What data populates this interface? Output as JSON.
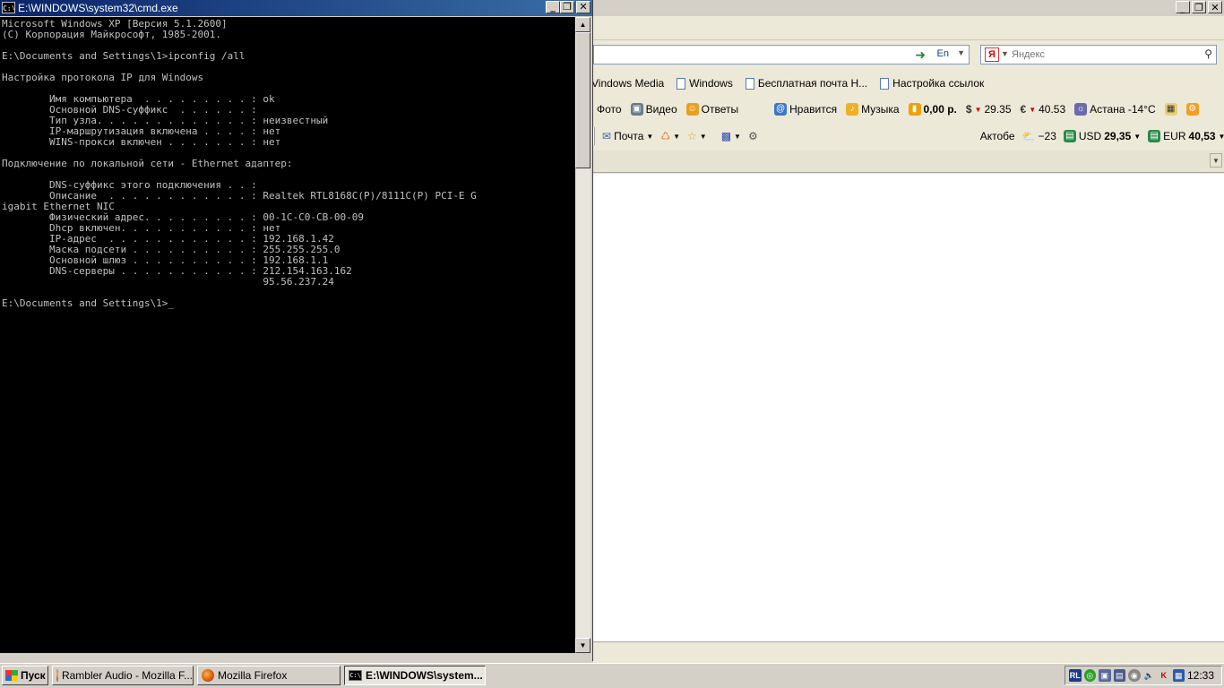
{
  "cmd": {
    "title": "E:\\WINDOWS\\system32\\cmd.exe",
    "icon_text": "C:\\",
    "console_lines": [
      "Microsoft Windows XP [Версия 5.1.2600]",
      "(С) Корпорация Майкрософт, 1985-2001.",
      "",
      "E:\\Documents and Settings\\1>ipconfig /all",
      "",
      "Настройка протокола IP для Windows",
      "",
      "        Имя компьютера  . . . . . . . . . : ok",
      "        Основной DNS-суффикс  . . . . . . :",
      "        Тип узла. . . . . . . . . . . . . : неизвестный",
      "        IP-маршрутизация включена . . . . : нет",
      "        WINS-прокси включен . . . . . . . : нет",
      "",
      "Подключение по локальной сети - Ethernet адаптер:",
      "",
      "        DNS-суффикс этого подключения . . :",
      "        Описание  . . . . . . . . . . . . : Realtek RTL8168C(P)/8111C(P) PCI-E G",
      "igabit Ethernet NIC",
      "        Физический адрес. . . . . . . . . : 00-1C-C0-CB-00-09",
      "        Dhcp включен. . . . . . . . . . . : нет",
      "        IP-адрес  . . . . . . . . . . . . : 192.168.1.42",
      "        Маска подсети . . . . . . . . . . : 255.255.255.0",
      "        Основной шлюз . . . . . . . . . . : 192.168.1.1",
      "        DNS-серверы . . . . . . . . . . . : 212.154.163.162",
      "                                            95.56.237.24",
      "",
      "E:\\Documents and Settings\\1>"
    ],
    "cursor": "_"
  },
  "firefox": {
    "url_lang": "En",
    "search_placeholder": "Яндекс",
    "bookmarks": [
      "Vindows Media",
      "Windows",
      "Бесплатная почта Н...",
      "Настройка ссылок"
    ],
    "yandex_bar": {
      "photo": "Фото",
      "video": "Видео",
      "answers": "Ответы",
      "likes": "Нравится",
      "music": "Музыка",
      "money": "0,00 р.",
      "usd": "29.35",
      "eur": "40.53",
      "weather_city": "Астана -14°C"
    },
    "toolbar3": {
      "mail": "Почта",
      "city": "Актобе",
      "temp": "−23",
      "usd_label": "USD",
      "usd_value": "29,35",
      "eur_label": "EUR",
      "eur_value": "40,53"
    }
  },
  "taskbar": {
    "start": "Пуск",
    "tasks": [
      "Rambler Audio - Mozilla F...",
      "Mozilla Firefox",
      "E:\\WINDOWS\\system..."
    ],
    "tray_lang": "RL",
    "clock": "12:33"
  }
}
